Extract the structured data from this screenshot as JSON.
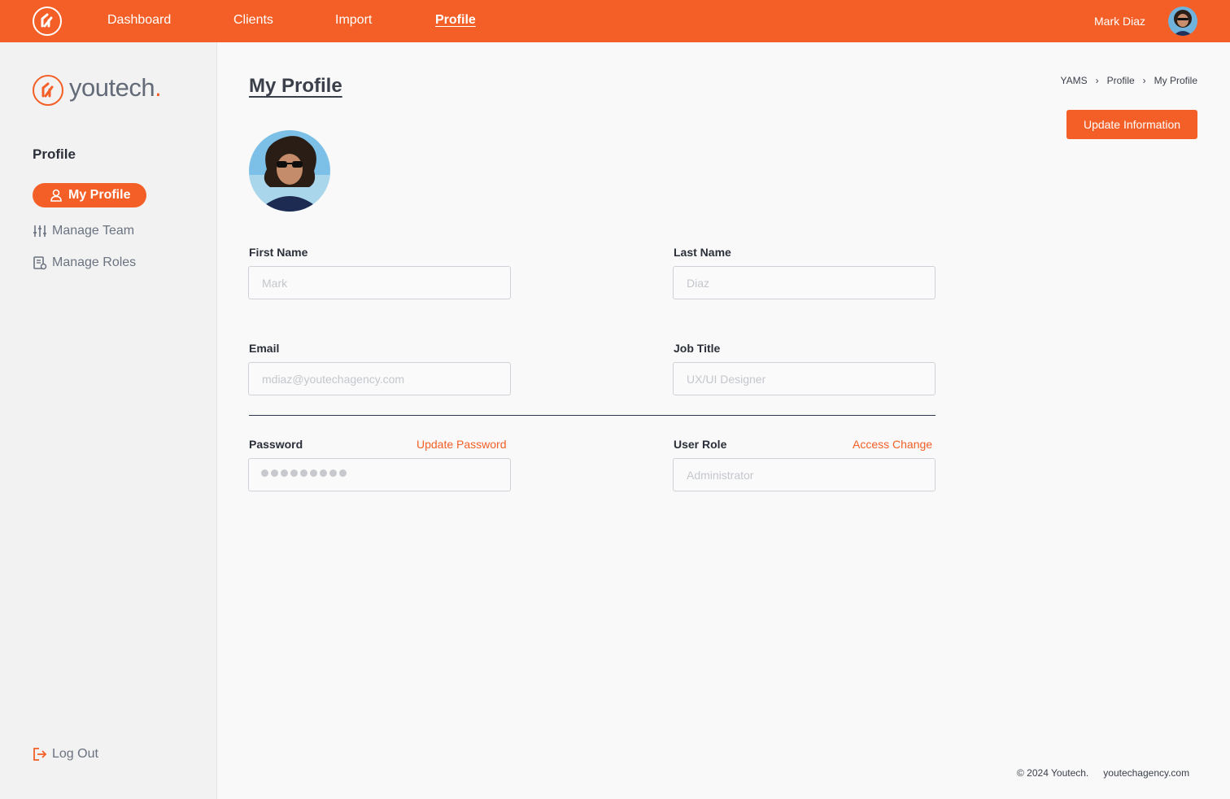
{
  "topbar": {
    "nav": [
      "Dashboard",
      "Clients",
      "Import",
      "Profile"
    ],
    "active_nav": "Profile",
    "user_name": "Mark Diaz"
  },
  "sidebar": {
    "brand": "youtech",
    "brand_dot": ".",
    "heading": "Profile",
    "items": [
      {
        "label": "My Profile",
        "icon": "user-icon",
        "active": true
      },
      {
        "label": "Manage Team",
        "icon": "sliders-icon",
        "active": false
      },
      {
        "label": "Manage Roles",
        "icon": "roles-document-icon",
        "active": false
      }
    ],
    "logout": "Log Out"
  },
  "main": {
    "title": "My Profile",
    "breadcrumb": [
      "YAMS",
      "Profile",
      "My Profile"
    ],
    "update_button": "Update Information",
    "fields": {
      "first_name": {
        "label": "First Name",
        "placeholder": "Mark"
      },
      "last_name": {
        "label": "Last Name",
        "placeholder": "Diaz"
      },
      "email": {
        "label": "Email",
        "placeholder": "mdiaz@youtechagency.com"
      },
      "job_title": {
        "label": "Job Title",
        "placeholder": "UX/UI Designer"
      },
      "password": {
        "label": "Password",
        "link": "Update Password",
        "masked_chars": 9
      },
      "user_role": {
        "label": "User Role",
        "link": "Access Change",
        "placeholder": "Administrator"
      }
    }
  },
  "footer": {
    "copyright": "© 2024 Youtech.",
    "site": "youtechagency.com"
  },
  "colors": {
    "accent": "#f35f26",
    "sidebar_bg": "#f2f2f2",
    "page_bg": "#f9f9f9",
    "text_dark": "#2b2f3a",
    "divider": "#2f3552"
  }
}
